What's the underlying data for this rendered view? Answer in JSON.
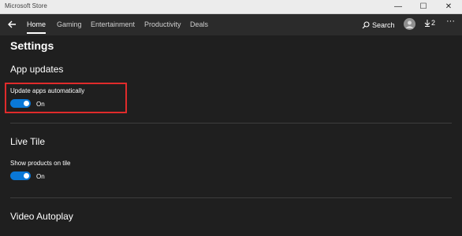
{
  "window": {
    "title": "Microsoft Store",
    "minimize_glyph": "—",
    "maximize_glyph": "☐",
    "close_glyph": "✕"
  },
  "nav": {
    "tabs": [
      {
        "label": "Home",
        "active": true
      },
      {
        "label": "Gaming",
        "active": false
      },
      {
        "label": "Entertainment",
        "active": false
      },
      {
        "label": "Productivity",
        "active": false
      },
      {
        "label": "Deals",
        "active": false
      }
    ],
    "search_label": "Search",
    "downloads_count": "2",
    "more_glyph": "···"
  },
  "page": {
    "title": "Settings",
    "sections": [
      {
        "heading": "App updates",
        "option_label": "Update apps automatically",
        "toggle_on": true,
        "toggle_state": "On"
      },
      {
        "heading": "Live Tile",
        "option_label": "Show products on tile",
        "toggle_on": true,
        "toggle_state": "On"
      },
      {
        "heading": "Video Autoplay"
      }
    ]
  },
  "colors": {
    "accent": "#0a78d7",
    "highlight": "#e02b2b",
    "background": "#1f1f1f"
  }
}
